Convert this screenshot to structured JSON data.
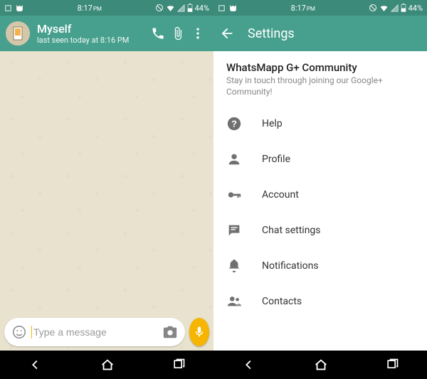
{
  "statusbar": {
    "time": "8:17",
    "time_suffix": "PM",
    "battery": "44%"
  },
  "chat": {
    "name": "Myself",
    "last_seen": "last seen today at 8:16 PM",
    "input_placeholder": "Type a message"
  },
  "settings": {
    "appbar_title": "Settings",
    "community_title": "WhatsMapp G+ Community",
    "community_sub": "Stay in touch through joining our Google+ Community!",
    "items": [
      {
        "label": "Help"
      },
      {
        "label": "Profile"
      },
      {
        "label": "Account"
      },
      {
        "label": "Chat settings"
      },
      {
        "label": "Notifications"
      },
      {
        "label": "Contacts"
      }
    ]
  }
}
